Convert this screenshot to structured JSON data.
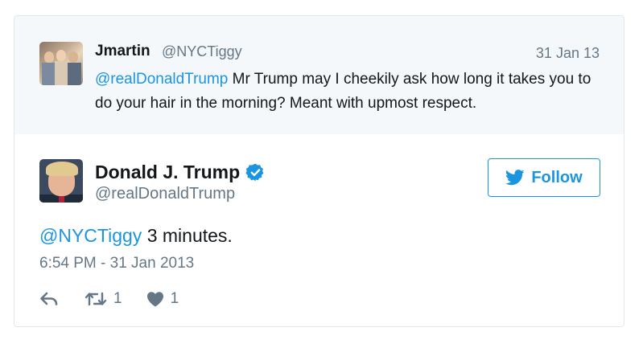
{
  "reply_context": {
    "name": "Jmartin",
    "handle": "@NYCTiggy",
    "date": "31 Jan 13",
    "mention": "@realDonaldTrump",
    "text": " Mr Trump may I cheekily ask how long it takes you to do your hair in the morning? Meant with upmost respect."
  },
  "tweet": {
    "name": "Donald J. Trump",
    "handle": "@realDonaldTrump",
    "verified_icon": "verified-badge-icon",
    "follow_label": "Follow",
    "mention": "@NYCTiggy",
    "text": " 3 minutes.",
    "timestamp": "6:54 PM - 31 Jan 2013",
    "retweet_count": "1",
    "like_count": "1"
  },
  "icons": {
    "reply": "reply-icon",
    "retweet": "retweet-icon",
    "like": "heart-icon",
    "bird": "twitter-bird-icon"
  },
  "colors": {
    "accent": "#1b95e0",
    "muted": "#657786",
    "context_bg": "#f5f8fa",
    "border": "#e1e8ed"
  }
}
